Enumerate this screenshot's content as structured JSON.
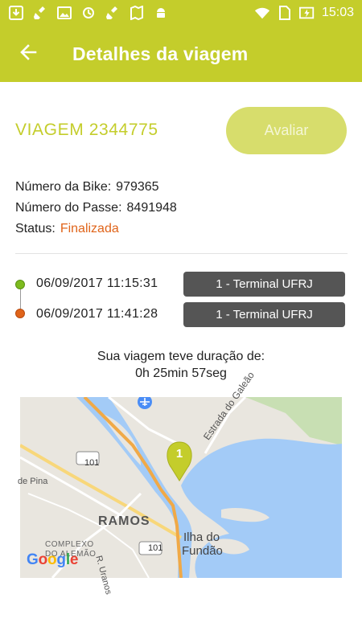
{
  "status_bar": {
    "time": "15:03",
    "left_icons": [
      "download-icon",
      "cleaner-icon",
      "image-icon",
      "sync-icon",
      "cleaner-icon",
      "map-icon",
      "android-icon"
    ],
    "right_icons": [
      "wifi-icon",
      "sim-icon",
      "battery-charging-icon"
    ]
  },
  "app_bar": {
    "title": "Detalhes da viagem",
    "back_icon": "arrow-back-icon"
  },
  "trip": {
    "title": "VIAGEM 2344775",
    "rate_label": "Avaliar",
    "bike_label": "Número da Bike:",
    "bike_value": "979365",
    "pass_label": "Número do Passe:",
    "pass_value": "8491948",
    "status_label": "Status:",
    "status_value": "Finalizada"
  },
  "timeline": {
    "start_time": "06/09/2017 11:15:31",
    "start_terminal": "1 - Terminal UFRJ",
    "end_time": "06/09/2017 11:41:28",
    "end_terminal": "1 - Terminal UFRJ"
  },
  "duration": {
    "label": "Sua viagem teve duração de:",
    "value": "0h 25min 57seg"
  },
  "map": {
    "marker_label": "1",
    "labels": {
      "ramos": "RAMOS",
      "ilha_line1": "Ilha do",
      "ilha_line2": "Fundão",
      "complexo_line1": "COMPLEXO",
      "complexo_line2": "DO ALEMÃO",
      "r_uranos": "R. Uranos",
      "estrada": "Estrada do Galeão",
      "de_pina": "de Pina",
      "road_101_a": "101",
      "road_101_b": "101"
    },
    "logo": "Google"
  },
  "colors": {
    "primary": "#c4cd2b",
    "button_disabled": "#d7dd6c",
    "status_finished": "#e0641a",
    "start_dot": "#7dbb1e",
    "terminal_badge": "#555555",
    "water": "#a3cbf7"
  }
}
